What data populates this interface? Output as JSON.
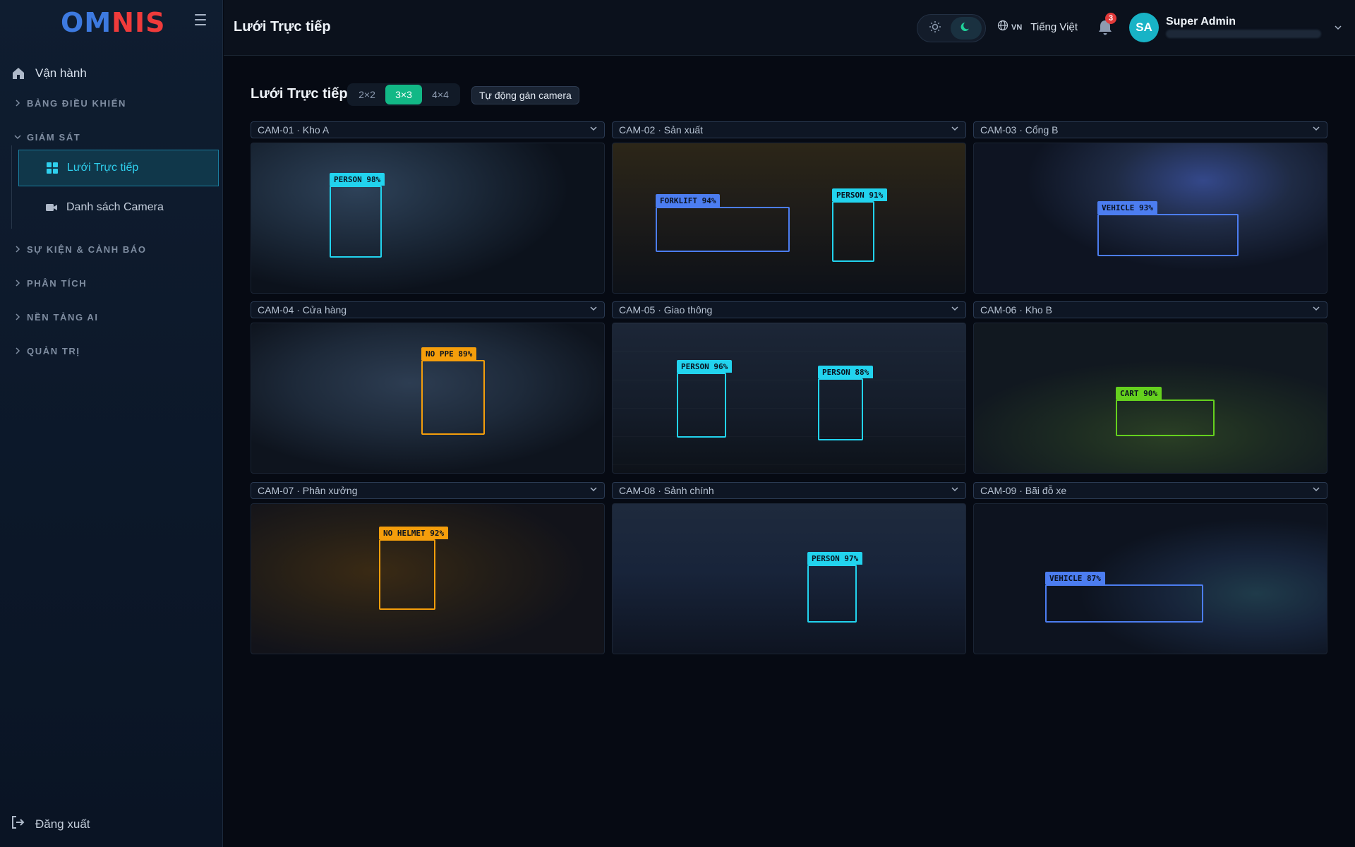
{
  "app": {
    "logo_letters": [
      "O",
      "M",
      "N",
      "I",
      "S"
    ]
  },
  "sidebar": {
    "top_item": "Vận hành",
    "sections": [
      {
        "label": "BẢNG ĐIỀU KHIỂN",
        "expanded": false
      },
      {
        "label": "GIÁM SÁT",
        "expanded": true
      },
      {
        "label": "SỰ KIỆN & CẢNH BÁO",
        "expanded": false
      },
      {
        "label": "PHÂN TÍCH",
        "expanded": false
      },
      {
        "label": "NỀN TẢNG AI",
        "expanded": false
      },
      {
        "label": "QUẢN TRỊ",
        "expanded": false
      }
    ],
    "monitoring_items": [
      {
        "label": "Lưới Trực tiếp",
        "active": true,
        "icon": "grid-icon"
      },
      {
        "label": "Danh sách Camera",
        "active": false,
        "icon": "video-camera-icon"
      }
    ],
    "logout": "Đăng xuất"
  },
  "header": {
    "page_title": "Lưới Trực tiếp",
    "language_code": "VN",
    "language_name": "Tiếng Việt",
    "notification_count": "3",
    "avatar_initials": "SA",
    "user_name": "Super Admin",
    "theme": "dark"
  },
  "main": {
    "title": "Lưới Trực tiếp",
    "layouts": [
      {
        "label": "2×2",
        "active": false
      },
      {
        "label": "3×3",
        "active": true
      },
      {
        "label": "4×4",
        "active": false
      }
    ],
    "auto_assign_label": "Tự động gán camera",
    "colors": {
      "person": "#22d3ee",
      "vehicle": "#4c7df0",
      "warning": "#f59e0b",
      "cart": "#65d11e"
    },
    "cameras": [
      {
        "name": "CAM-01 · Kho A",
        "detections": [
          {
            "label": "PERSON 98%",
            "kind": "person"
          }
        ]
      },
      {
        "name": "CAM-02 · Sản xuất",
        "detections": [
          {
            "label": "FORKLIFT 94%",
            "kind": "vehicle"
          },
          {
            "label": "PERSON 91%",
            "kind": "person"
          }
        ]
      },
      {
        "name": "CAM-03 · Cổng B",
        "detections": [
          {
            "label": "VEHICLE 93%",
            "kind": "vehicle"
          }
        ]
      },
      {
        "name": "CAM-04 · Cửa hàng",
        "detections": [
          {
            "label": "NO PPE 89%",
            "kind": "warning"
          }
        ]
      },
      {
        "name": "CAM-05 · Giao thông",
        "detections": [
          {
            "label": "PERSON 96%",
            "kind": "person"
          },
          {
            "label": "PERSON 88%",
            "kind": "person"
          }
        ]
      },
      {
        "name": "CAM-06 · Kho B",
        "detections": [
          {
            "label": "CART 90%",
            "kind": "cart"
          }
        ]
      },
      {
        "name": "CAM-07 · Phân xưởng",
        "detections": [
          {
            "label": "NO HELMET 92%",
            "kind": "warning"
          }
        ]
      },
      {
        "name": "CAM-08 · Sảnh chính",
        "detections": [
          {
            "label": "PERSON 97%",
            "kind": "person"
          }
        ]
      },
      {
        "name": "CAM-09 · Bãi đỗ xe",
        "detections": [
          {
            "label": "VEHICLE 87%",
            "kind": "vehicle"
          }
        ]
      }
    ]
  }
}
